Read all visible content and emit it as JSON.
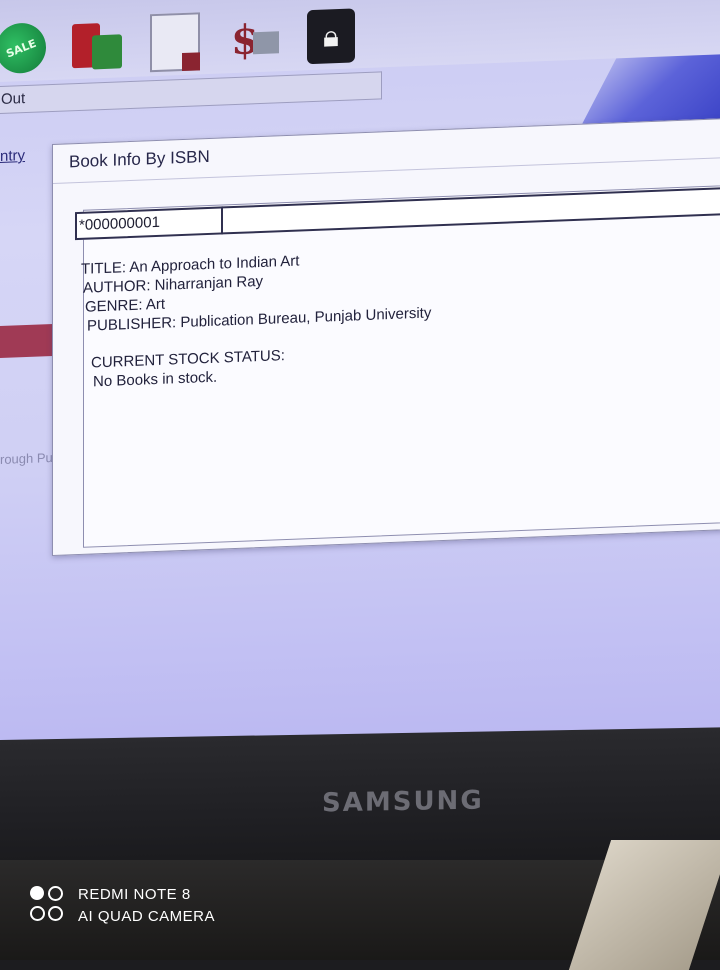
{
  "toolbar": {
    "icons": [
      "sale-badge-icon",
      "books-icon",
      "document-icon",
      "dollar-icon",
      "lock-icon"
    ],
    "sale_badge_text": "SALE"
  },
  "sidebar": {
    "out_field_value": "Out",
    "link_label": "ntry",
    "partial_text": "rough Purch"
  },
  "dialog": {
    "title": "Book Info By ISBN",
    "isbn_value": "*000000001",
    "title_line": "TITLE: An Approach to Indian Art",
    "author_line": "AUTHOR: Niharranjan Ray",
    "genre_line": "GENRE: Art",
    "publisher_line": "PUBLISHER: Publication Bureau, Punjab University",
    "stock_heading": "CURRENT STOCK STATUS:",
    "stock_status": "No Books in stock."
  },
  "monitor": {
    "brand": "SAMSUNG"
  },
  "watermark": {
    "line1": "REDMI NOTE 8",
    "line2": "AI QUAD CAMERA"
  },
  "colors": {
    "screen_bg": "#cfcff4",
    "dialog_bg": "#f7f7fd",
    "accent_maroon": "#a03a55",
    "text_dark": "#22223c"
  }
}
